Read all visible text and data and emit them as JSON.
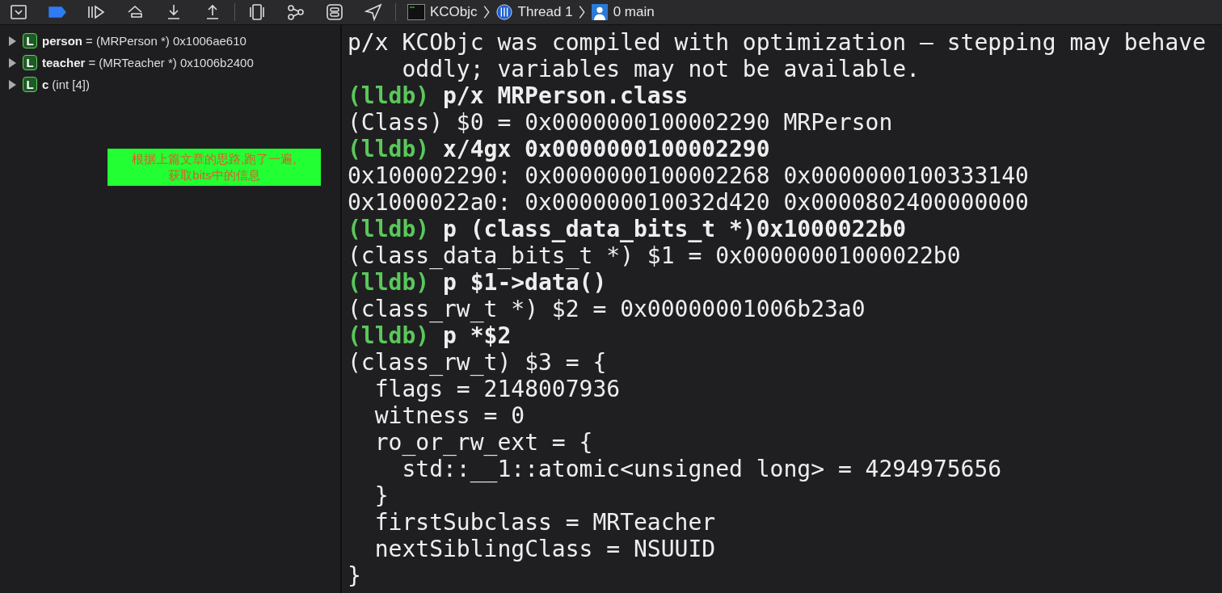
{
  "toolbar": {
    "breakpoints_active": true,
    "breadcrumb": [
      {
        "kind": "target",
        "label": "KCObjc"
      },
      {
        "kind": "thread",
        "label": "Thread 1"
      },
      {
        "kind": "frame",
        "label": "0 main"
      }
    ]
  },
  "variables": [
    {
      "badge": "L",
      "name": "person",
      "expanded": false,
      "detail": "= (MRPerson *) 0x1006ae610"
    },
    {
      "badge": "L",
      "name": "teacher",
      "expanded": false,
      "detail": "= (MRTeacher *) 0x1006b2400"
    },
    {
      "badge": "L",
      "name": "c",
      "expanded": false,
      "detail": "(int [4])"
    }
  ],
  "note": {
    "lines": [
      "根据上篇文章的思路,跑了一遍,",
      "获取bits中的信息"
    ]
  },
  "console": [
    {
      "kind": "output",
      "text": "p/x KCObjc was compiled with optimization – stepping may behave oddly; variables may not be available."
    },
    {
      "kind": "command",
      "prompt": "(lldb)",
      "text": "p/x MRPerson.class"
    },
    {
      "kind": "output",
      "text": "(Class) $0 = 0x0000000100002290 MRPerson"
    },
    {
      "kind": "command",
      "prompt": "(lldb)",
      "text": "x/4gx 0x0000000100002290"
    },
    {
      "kind": "output",
      "text": "0x100002290: 0x0000000100002268 0x0000000100333140"
    },
    {
      "kind": "output",
      "text": "0x1000022a0: 0x000000010032d420 0x0000802400000000"
    },
    {
      "kind": "command",
      "prompt": "(lldb)",
      "text": "p (class_data_bits_t *)0x1000022b0"
    },
    {
      "kind": "output",
      "text": "(class_data_bits_t *) $1 = 0x00000001000022b0"
    },
    {
      "kind": "command",
      "prompt": "(lldb)",
      "text": "p $1->data()"
    },
    {
      "kind": "output",
      "text": "(class_rw_t *) $2 = 0x00000001006b23a0"
    },
    {
      "kind": "command",
      "prompt": "(lldb)",
      "text": "p *$2"
    },
    {
      "kind": "output",
      "text": "(class_rw_t) $3 = {"
    },
    {
      "kind": "output",
      "text": "  flags = 2148007936"
    },
    {
      "kind": "output",
      "text": "  witness = 0"
    },
    {
      "kind": "output",
      "text": "  ro_or_rw_ext = {"
    },
    {
      "kind": "output",
      "text": "    std::__1::atomic<unsigned long> = 4294975656"
    },
    {
      "kind": "output",
      "text": "  }"
    },
    {
      "kind": "output",
      "text": "  firstSubclass = MRTeacher"
    },
    {
      "kind": "output",
      "text": "  nextSiblingClass = NSUUID"
    },
    {
      "kind": "output",
      "text": "}"
    }
  ]
}
